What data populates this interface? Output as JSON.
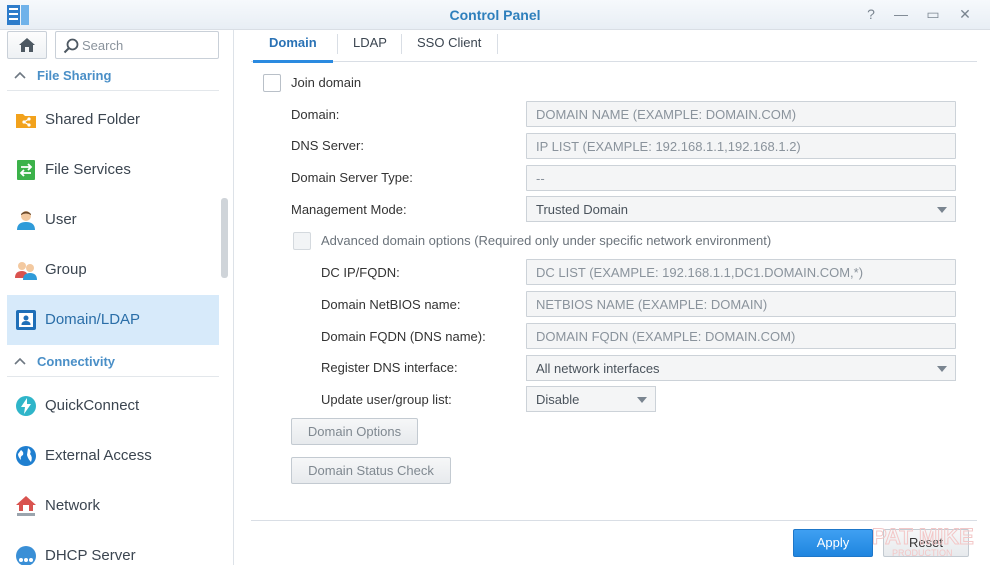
{
  "window": {
    "title": "Control Panel",
    "controls": {
      "help": "?",
      "minimize": "—",
      "maximize": "▭",
      "close": "✕"
    }
  },
  "sidebar": {
    "search_placeholder": "Search",
    "sections": [
      {
        "label": "File Sharing",
        "items": [
          {
            "label": "Shared Folder",
            "icon": "shared-folder-icon"
          },
          {
            "label": "File Services",
            "icon": "file-services-icon"
          },
          {
            "label": "User",
            "icon": "user-icon"
          },
          {
            "label": "Group",
            "icon": "group-icon"
          },
          {
            "label": "Domain/LDAP",
            "icon": "domain-ldap-icon",
            "active": true
          }
        ]
      },
      {
        "label": "Connectivity",
        "items": [
          {
            "label": "QuickConnect",
            "icon": "quickconnect-icon"
          },
          {
            "label": "External Access",
            "icon": "globe-icon"
          },
          {
            "label": "Network",
            "icon": "network-icon"
          },
          {
            "label": "DHCP Server",
            "icon": "dhcp-icon"
          }
        ]
      }
    ]
  },
  "tabs": [
    {
      "label": "Domain",
      "active": true
    },
    {
      "label": "LDAP"
    },
    {
      "label": "SSO Client"
    }
  ],
  "form": {
    "join_domain": {
      "label": "Join domain",
      "checked": false
    },
    "domain": {
      "label": "Domain:",
      "placeholder": "DOMAIN NAME (EXAMPLE: DOMAIN.COM)"
    },
    "dns_server": {
      "label": "DNS Server:",
      "placeholder": "IP LIST (EXAMPLE: 192.168.1.1,192.168.1.2)"
    },
    "domain_server_type": {
      "label": "Domain Server Type:",
      "value": "--"
    },
    "management_mode": {
      "label": "Management Mode:",
      "value": "Trusted Domain"
    },
    "advanced": {
      "label": "Advanced domain options (Required only under specific network environment)",
      "checked": false
    },
    "dc_ip": {
      "label": "DC IP/FQDN:",
      "placeholder": "DC LIST (EXAMPLE: 192.168.1.1,DC1.DOMAIN.COM,*)"
    },
    "netbios": {
      "label": "Domain NetBIOS name:",
      "placeholder": "NETBIOS NAME (EXAMPLE: DOMAIN)"
    },
    "fqdn": {
      "label": "Domain FQDN (DNS name):",
      "placeholder": "DOMAIN FQDN (EXAMPLE: DOMAIN.COM)"
    },
    "register_dns": {
      "label": "Register DNS interface:",
      "value": "All network interfaces"
    },
    "update_list": {
      "label": "Update user/group list:",
      "value": "Disable"
    },
    "domain_options_button": "Domain Options",
    "domain_status_button": "Domain Status Check"
  },
  "footer": {
    "apply": "Apply",
    "reset": "Reset"
  },
  "watermark": {
    "text": "PAT MIKE",
    "subtext": "PRODUCTION"
  },
  "colors": {
    "accent": "#2a8ae0",
    "section_header": "#4a8fc7",
    "active_nav_bg": "#d7eafa"
  }
}
